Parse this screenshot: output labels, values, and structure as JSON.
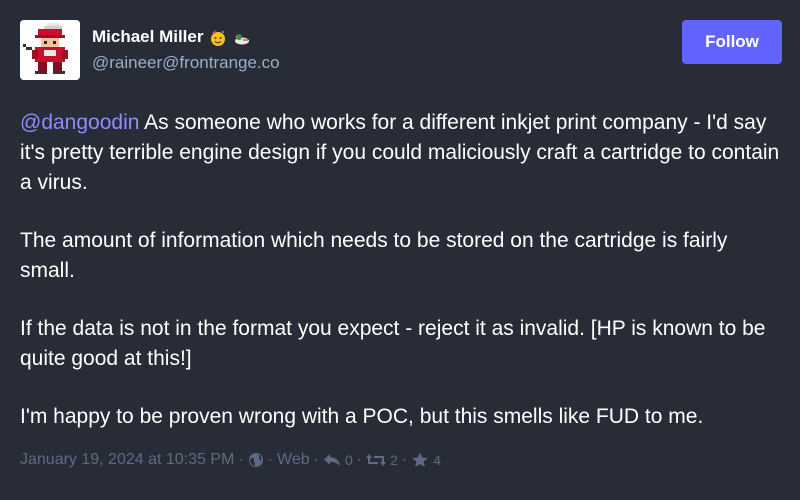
{
  "author": {
    "display_name": "Michael Miller",
    "handle": "@raineer@frontrange.co",
    "emojis": [
      "party-face-emoji",
      "duck-emoji"
    ]
  },
  "follow_button": {
    "label": "Follow"
  },
  "post": {
    "mention": "@dangoodin",
    "paragraph_1_rest": " As someone who works for a different inkjet print company - I'd say it's pretty terrible engine design if you could maliciously craft a cartridge to contain a virus.",
    "paragraph_2": "The amount of information which needs to be stored on the cartridge is fairly small.",
    "paragraph_3": "If the data is not in the format you expect - reject it as invalid. [HP is known to be quite good at this!]",
    "paragraph_4": "I'm happy to be proven wrong with a POC, but this smells like FUD to me."
  },
  "meta": {
    "timestamp": "January 19, 2024 at 10:35 PM",
    "separator": "·",
    "visibility_icon": "globe-icon",
    "source": "Web",
    "replies": "0",
    "boosts": "2",
    "favourites": "4"
  },
  "colors": {
    "background": "#282c37",
    "accent": "#6364ff",
    "mention": "#8c8dff",
    "muted": "#606984",
    "handle": "#9baec8"
  }
}
